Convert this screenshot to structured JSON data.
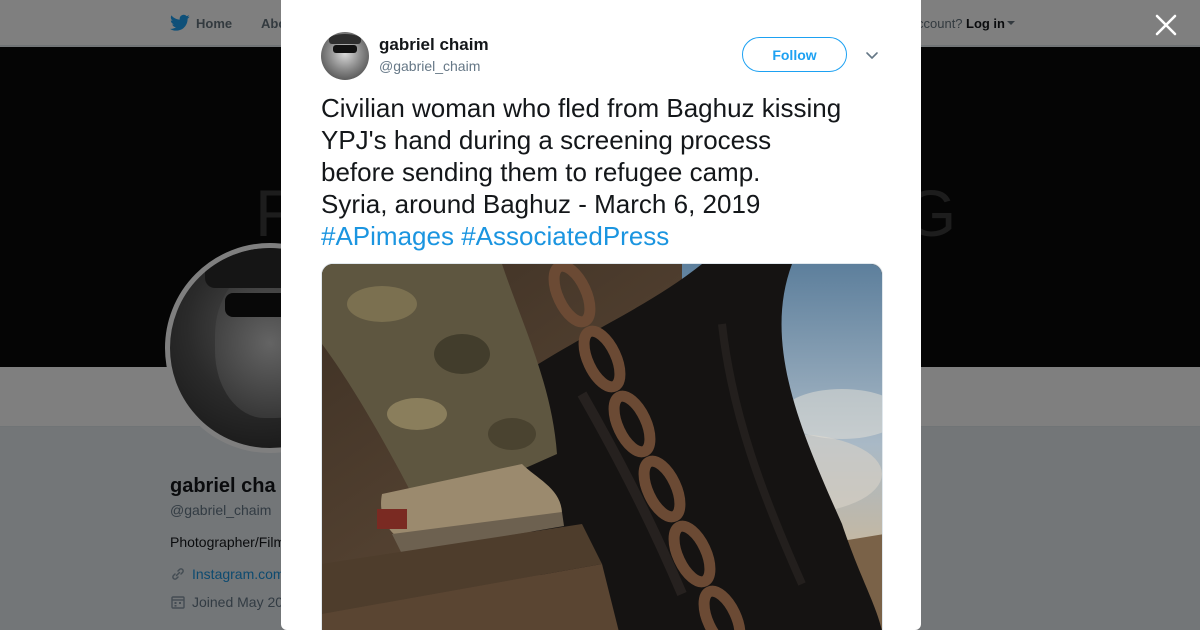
{
  "background_page": {
    "nav": {
      "home_label": "Home",
      "about_label": "Abo",
      "account_prompt": "ccount?",
      "login_label": "Log in"
    },
    "banner": {
      "text_left": "F",
      "text_right": "G"
    },
    "profile": {
      "name": "gabriel cha",
      "handle": "@gabriel_chaim",
      "bio": "Photographer/Film",
      "link": "Instagram.com",
      "joined": "Joined May 20"
    }
  },
  "tweet": {
    "author_name": "gabriel chaim",
    "author_handle": "@gabriel_chaim",
    "follow_label": "Follow",
    "text_lines": [
      "Civilian woman who fled from Baghuz kissing",
      "YPJ's hand during a screening process",
      "before sending them to refugee camp.",
      "Syria, around Baghuz - March 6, 2019"
    ],
    "hashtags": [
      "#APimages",
      "#AssociatedPress"
    ]
  },
  "colors": {
    "accent": "#1da1f2",
    "link": "#1b95e0",
    "text": "#14171a",
    "secondary_text": "#657786",
    "overlay": "rgba(0,0,0,0.5)"
  },
  "icons": {
    "nav_logo": "twitter-bird-icon",
    "close": "close-icon",
    "caret": "chevron-down-icon",
    "link": "link-icon",
    "calendar": "calendar-icon"
  }
}
